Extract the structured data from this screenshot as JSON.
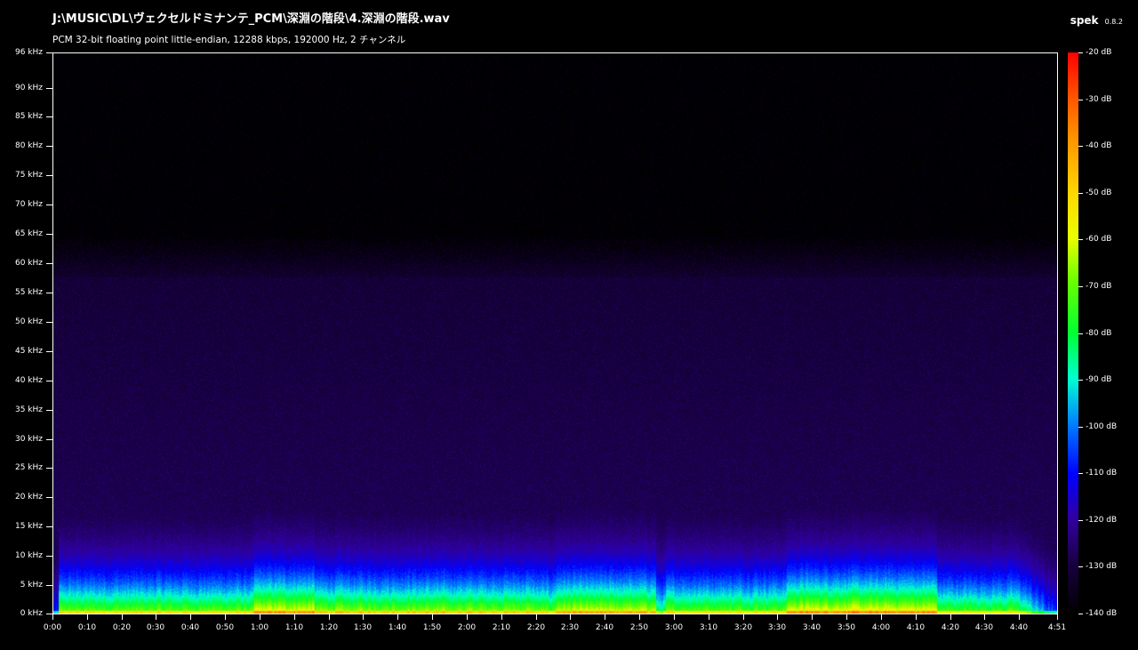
{
  "header": {
    "file_path": "J:\\MUSIC\\DL\\ヴェクセルドミナンテ_PCM\\深淵の階段\\4.深淵の階段.wav",
    "file_info": "PCM 32-bit floating point little-endian, 12288 kbps, 192000 Hz, 2 チャンネル",
    "app_name": "spek",
    "app_version": "0.8.2"
  },
  "frequency_axis": {
    "max_khz": 96,
    "labels": [
      "96 kHz",
      "90 kHz",
      "85 kHz",
      "80 kHz",
      "75 kHz",
      "70 kHz",
      "65 kHz",
      "60 kHz",
      "55 kHz",
      "50 kHz",
      "45 kHz",
      "40 kHz",
      "35 kHz",
      "30 kHz",
      "25 kHz",
      "20 kHz",
      "15 kHz",
      "10 kHz",
      "5 kHz",
      "0 kHz"
    ],
    "values_khz": [
      96,
      90,
      85,
      80,
      75,
      70,
      65,
      60,
      55,
      50,
      45,
      40,
      35,
      30,
      25,
      20,
      15,
      10,
      5,
      0
    ]
  },
  "time_axis": {
    "duration_seconds": 291,
    "labels": [
      "0:00",
      "0:10",
      "0:20",
      "0:30",
      "0:40",
      "0:50",
      "1:00",
      "1:10",
      "1:20",
      "1:30",
      "1:40",
      "1:50",
      "2:00",
      "2:10",
      "2:20",
      "2:30",
      "2:40",
      "2:50",
      "3:00",
      "3:10",
      "3:20",
      "3:30",
      "3:40",
      "3:50",
      "4:00",
      "4:10",
      "4:20",
      "4:30",
      "4:40",
      "4:51"
    ],
    "values_seconds": [
      0,
      10,
      20,
      30,
      40,
      50,
      60,
      70,
      80,
      90,
      100,
      110,
      120,
      130,
      140,
      150,
      160,
      170,
      180,
      190,
      200,
      210,
      220,
      230,
      240,
      250,
      260,
      270,
      280,
      291
    ]
  },
  "colorbar": {
    "max_db": -20,
    "min_db": -140,
    "labels": [
      "-20 dB",
      "-30 dB",
      "-40 dB",
      "-50 dB",
      "-60 dB",
      "-70 dB",
      "-80 dB",
      "-90 dB",
      "-100 dB",
      "-110 dB",
      "-120 dB",
      "-130 dB",
      "-140 dB"
    ],
    "values_db": [
      -20,
      -30,
      -40,
      -50,
      -60,
      -70,
      -80,
      -90,
      -100,
      -110,
      -120,
      -130,
      -140
    ]
  }
}
